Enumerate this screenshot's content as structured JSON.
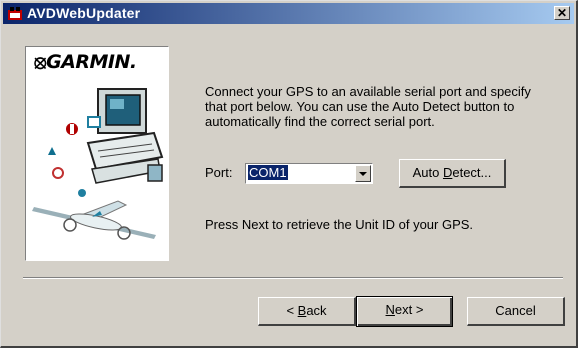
{
  "window": {
    "title": "AVDWebUpdater",
    "close_glyph": "✕"
  },
  "logo": {
    "mark": "⦻",
    "brand": "GARMIN."
  },
  "content": {
    "instructions": "Connect your GPS to an available serial port and specify that port below.  You can use the Auto Detect button to automatically find the correct serial port.",
    "port_label": "Port:",
    "port_value": "COM1",
    "auto_detect_pre": "Auto ",
    "auto_detect_accel": "D",
    "auto_detect_post": "etect...",
    "next_instruction": "Press Next to retrieve the Unit ID of your GPS."
  },
  "buttons": {
    "back_pre": "< ",
    "back_accel": "B",
    "back_post": "ack",
    "next_accel": "N",
    "next_post": "ext >",
    "cancel": "Cancel"
  },
  "icons": [
    "app-icon",
    "close-icon",
    "garmin-logo-icon",
    "computer-icon",
    "airplane-icon",
    "dropdown-arrow-icon"
  ],
  "colors": {
    "title_start": "#0a246a",
    "title_end": "#a6caf0",
    "face": "#d4d0c8",
    "selection": "#0a246a"
  }
}
